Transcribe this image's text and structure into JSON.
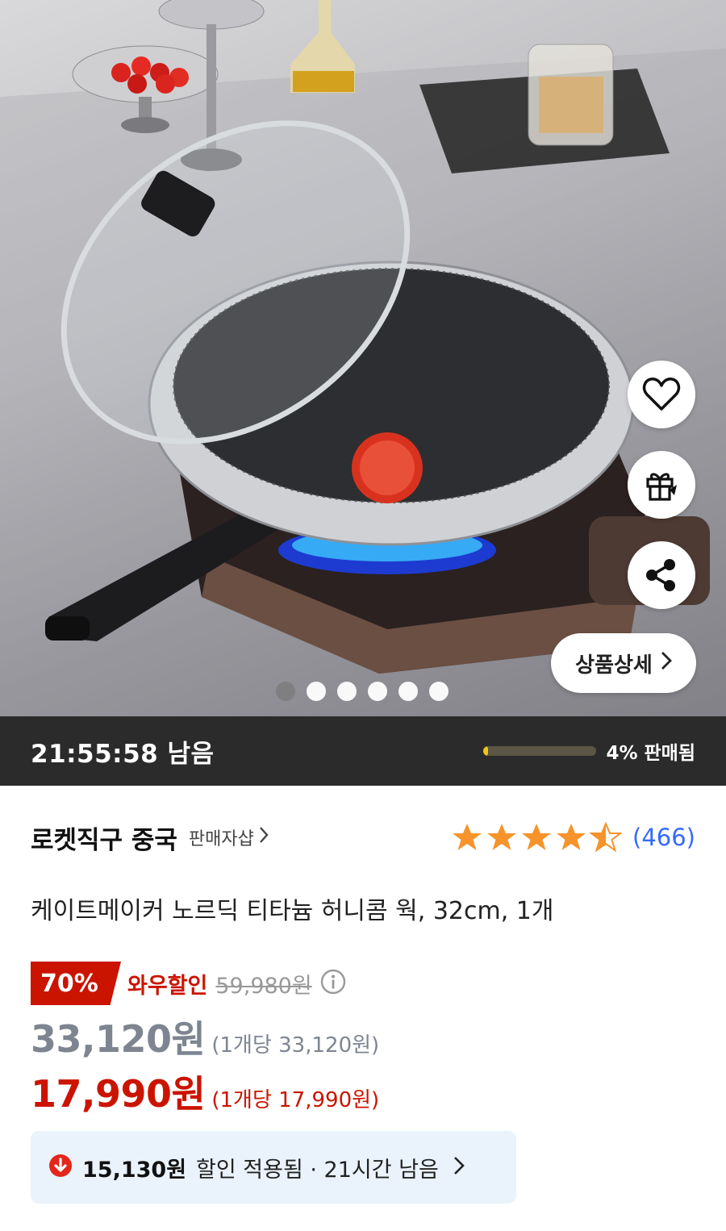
{
  "gallery": {
    "dots_total": 6,
    "active_dot": 0,
    "detail_button_label": "상품상세"
  },
  "timer": {
    "remaining": "21:55:58 남음",
    "sold_percent": 4,
    "sold_label": "4% 판매됨",
    "bar_color": "#f0c417"
  },
  "seller": {
    "name": "로켓직구 중국",
    "link_label": "판매자샵"
  },
  "rating": {
    "stars": 4.5,
    "review_count": "(466)"
  },
  "product": {
    "title": "케이트메이커 노르딕 티타늄 허니콤 웍, 32cm, 1개"
  },
  "pricing": {
    "discount_badge": "70%",
    "wow_label": "와우할인",
    "original_price": "59,980원",
    "sale_price": "33,120원",
    "sale_unit_price": "(1개당 33,120원)",
    "final_price": "17,990원",
    "final_unit_price": "(1개당 17,990원)",
    "accent_color": "#cb1400"
  },
  "coupon": {
    "amount": "15,130원",
    "text": "할인 적용됨 · 21시간 남음"
  },
  "icons": {
    "like": "heart-icon",
    "gift": "gift-icon",
    "share": "share-icon"
  }
}
